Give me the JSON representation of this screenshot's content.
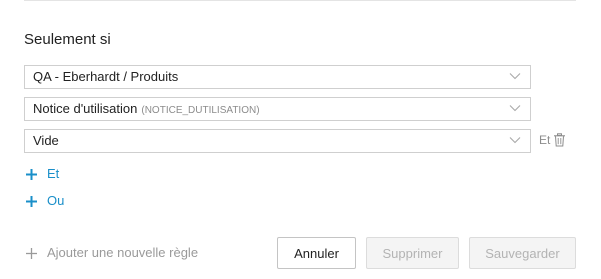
{
  "section": {
    "title": "Seulement si"
  },
  "conditions": {
    "category": {
      "value": "QA - Eberhardt / Produits"
    },
    "attribute": {
      "value": "Notice d'utilisation",
      "code": "(NOTICE_DUTILISATION)"
    },
    "operator": {
      "value": "Vide"
    },
    "and_inline_label": "Et"
  },
  "links": {
    "and_label": "Et",
    "or_label": "Ou",
    "add_rule_label": "Ajouter une nouvelle règle"
  },
  "buttons": {
    "cancel_label": "Annuler",
    "delete_label": "Supprimer",
    "save_label": "Sauvegarder"
  },
  "icons": {
    "chevron": "chevron-down-icon",
    "trash": "trash-icon",
    "plus": "plus-icon"
  },
  "colors": {
    "link_blue": "#1a8fc9",
    "muted_text": "#9a9a9a",
    "border": "#cfcfcf",
    "disabled_button_bg": "#f4f4f4"
  }
}
